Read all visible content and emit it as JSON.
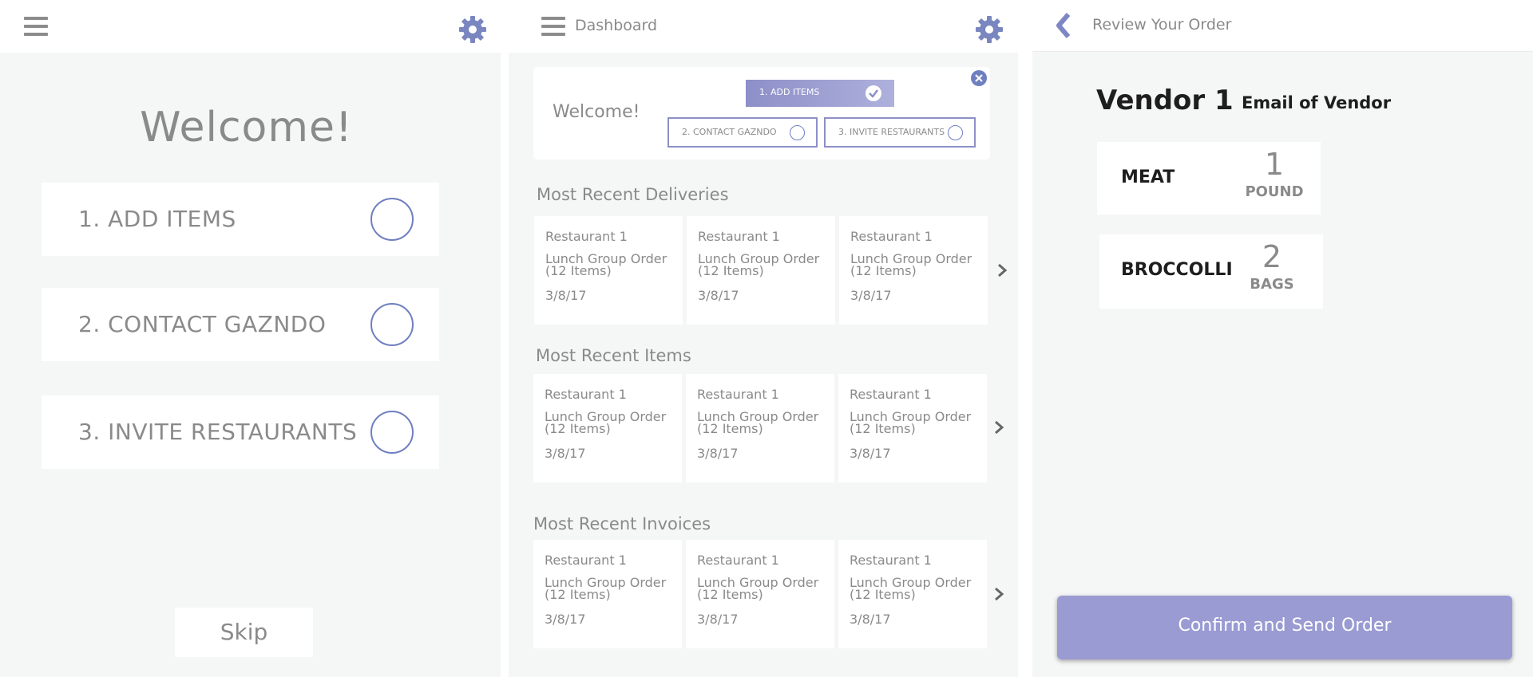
{
  "onboarding": {
    "title": "Welcome!",
    "steps": [
      {
        "label": "1. ADD ITEMS"
      },
      {
        "label": "2. CONTACT GAZNDO"
      },
      {
        "label": "3. INVITE RESTAURANTS"
      }
    ],
    "skip_label": "Skip"
  },
  "dashboard": {
    "title": "Dashboard",
    "welcome": {
      "title": "Welcome!",
      "steps": [
        {
          "label": "1. ADD ITEMS",
          "done": true
        },
        {
          "label": "2. CONTACT GAZNDO",
          "done": false
        },
        {
          "label": "3. INVITE RESTAURANTS",
          "done": false
        }
      ]
    },
    "sections": [
      {
        "title": "Most Recent Deliveries",
        "cards": [
          {
            "restaurant": "Restaurant 1",
            "order": "Lunch Group Order (12 Items)",
            "date": "3/8/17"
          },
          {
            "restaurant": "Restaurant 1",
            "order": "Lunch Group Order (12 Items)",
            "date": "3/8/17"
          },
          {
            "restaurant": "Restaurant 1",
            "order": "Lunch Group Order (12 Items)",
            "date": "3/8/17"
          }
        ]
      },
      {
        "title": "Most Recent Items",
        "cards": [
          {
            "restaurant": "Restaurant 1",
            "order": "Lunch Group Order (12 Items)",
            "date": "3/8/17"
          },
          {
            "restaurant": "Restaurant 1",
            "order": "Lunch Group Order (12 Items)",
            "date": "3/8/17"
          },
          {
            "restaurant": "Restaurant 1",
            "order": "Lunch Group Order (12 Items)",
            "date": "3/8/17"
          }
        ]
      },
      {
        "title": "Most Recent Invoices",
        "cards": [
          {
            "restaurant": "Restaurant 1",
            "order": "Lunch Group Order (12 Items)",
            "date": "3/8/17"
          },
          {
            "restaurant": "Restaurant 1",
            "order": "Lunch Group Order (12 Items)",
            "date": "3/8/17"
          },
          {
            "restaurant": "Restaurant 1",
            "order": "Lunch Group Order (12 Items)",
            "date": "3/8/17"
          }
        ]
      }
    ]
  },
  "review": {
    "title": "Review Your Order",
    "vendor_name": "Vendor 1",
    "vendor_email": "Email of Vendor",
    "items": [
      {
        "name": "MEAT",
        "qty": "1",
        "unit": "POUND"
      },
      {
        "name": "BROCCOLLI",
        "qty": "2",
        "unit": "BAGS"
      }
    ],
    "confirm_label": "Confirm and Send Order"
  },
  "colors": {
    "accent": "#9a9bd3",
    "accent_dark": "#6f7fc0",
    "icon_gray": "#8c8c8c",
    "gear_blue": "#7a86c0",
    "panel_bg": "#f5f6f6"
  },
  "icons": {
    "menu": "hamburger-icon",
    "settings": "gear-icon",
    "back": "chevron-left-icon",
    "next": "chevron-right-icon",
    "check": "check-circle-icon",
    "close": "close-circle-icon"
  }
}
